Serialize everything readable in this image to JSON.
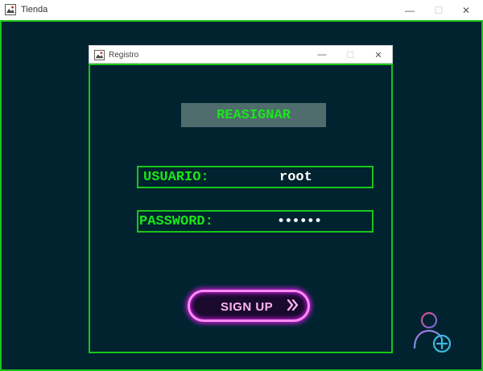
{
  "outer_window": {
    "title": "Tienda",
    "icon": "java-app-icon",
    "controls": {
      "minimize": "—",
      "maximize": "☐",
      "close": "✕"
    }
  },
  "dialog": {
    "title": "Registro",
    "icon": "java-app-icon",
    "controls": {
      "minimize": "—",
      "maximize": "☐",
      "close": "✕"
    },
    "heading": "REASIGNAR",
    "fields": [
      {
        "label": "USUARIO:",
        "value": "root"
      },
      {
        "label": "PASSWORD:",
        "value": "••••••"
      }
    ],
    "signup_button": {
      "label": "SIGN UP",
      "icon": "double-chevron-right-icon"
    }
  },
  "corner_icon": "add-user-icon",
  "colors": {
    "background": "#012330",
    "accent_green": "#17c617",
    "heading_bg": "#4f6d6d",
    "neon_pink": "#ff8cf0",
    "neon_purple": "#c21bd6"
  }
}
